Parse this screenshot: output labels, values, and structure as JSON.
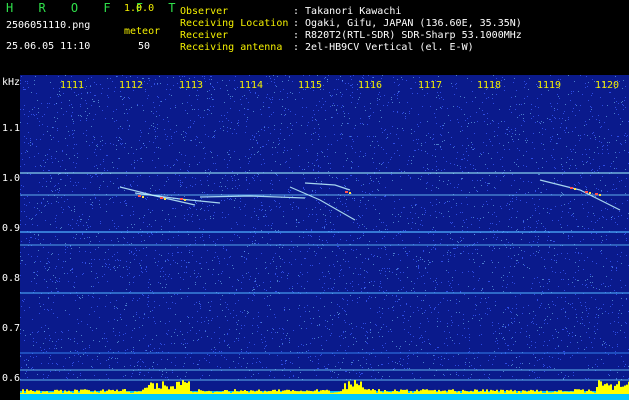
{
  "app": {
    "name": "H R O F F T",
    "version": "1.0.0"
  },
  "file": {
    "name": "2506051110.png",
    "datetime": "25.06.05 11:10"
  },
  "mode": {
    "label": "meteor",
    "count": "50"
  },
  "info": [
    {
      "key": "Observer",
      "value": ": Takanori Kawachi"
    },
    {
      "key": "Receiving Location",
      "value": ": Ogaki, Gifu, JAPAN (136.60E, 35.35N)"
    },
    {
      "key": "Receiver",
      "value": ": R820T2(RTL-SDR) SDR-Sharp 53.1000MHz"
    },
    {
      "key": "Receiving antenna",
      "value": ": 2el-HB9CV Vertical (el. E-W)"
    }
  ],
  "axis": {
    "y_unit": "kHz",
    "y_ticks": [
      "1.1",
      "1.0",
      "0.9",
      "0.8",
      "0.7",
      "0.6"
    ],
    "x_ticks": [
      "1111",
      "1112",
      "1113",
      "1114",
      "1115",
      "1116",
      "1117",
      "1118",
      "1119",
      "1120"
    ]
  },
  "colors": {
    "background": "#0a1a8c",
    "header_green": "#2fe04a",
    "header_yellow": "#f4f000",
    "bottom_band": "#00c8ff",
    "bottom_spikes": "#ffff00"
  }
}
